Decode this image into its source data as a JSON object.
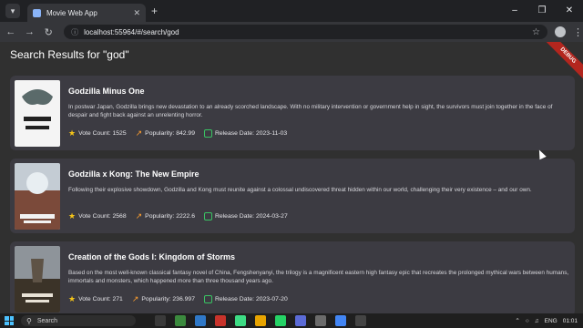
{
  "browser": {
    "tab_title": "Movie Web App",
    "url": "localhost:55964/#/search/god",
    "debug_banner": "DEBUG"
  },
  "page": {
    "title": "Search Results for \"god\""
  },
  "labels": {
    "vote_count": "Vote Count:",
    "popularity": "Popularity:",
    "release_date": "Release Date:"
  },
  "results": [
    {
      "title": "Godzilla Minus One",
      "overview": "In postwar Japan, Godzilla brings new devastation to an already scorched landscape. With no military intervention or government help in sight, the survivors must join together in the face of despair and fight back against an unrelenting horror.",
      "vote_count": "1525",
      "popularity": "842.99",
      "release_date": "2023-11-03",
      "poster_text": "GODZILLA MINUS ONE",
      "poster_colors": [
        "#f2f2f2",
        "#6b6b6b"
      ]
    },
    {
      "title": "Godzilla x Kong: The New Empire",
      "overview": "Following their explosive showdown, Godzilla and Kong must reunite against a colossal undiscovered threat hidden within our world, challenging their very existence – and our own.",
      "vote_count": "2568",
      "popularity": "2222.6",
      "release_date": "2024-03-27",
      "poster_text": "GODZILLA x KONG THE NEW EMPIRE",
      "poster_colors": [
        "#c9d3dc",
        "#b84a3a"
      ]
    },
    {
      "title": "Creation of the Gods I: Kingdom of Storms",
      "overview": "Based on the most well-known classical fantasy novel of China, Fengshenyanyi, the trilogy is a magnificent eastern high fantasy epic that recreates the prolonged mythical wars between humans, immortals and monsters, which happened more than three thousand years ago.",
      "vote_count": "271",
      "popularity": "236.997",
      "release_date": "2023-07-20",
      "poster_text": "CREATION OF THE GODS",
      "poster_colors": [
        "#8a8f95",
        "#3a3226"
      ]
    }
  ],
  "taskbar": {
    "search_label": "Search",
    "language": "ENG",
    "time": "01:01"
  }
}
